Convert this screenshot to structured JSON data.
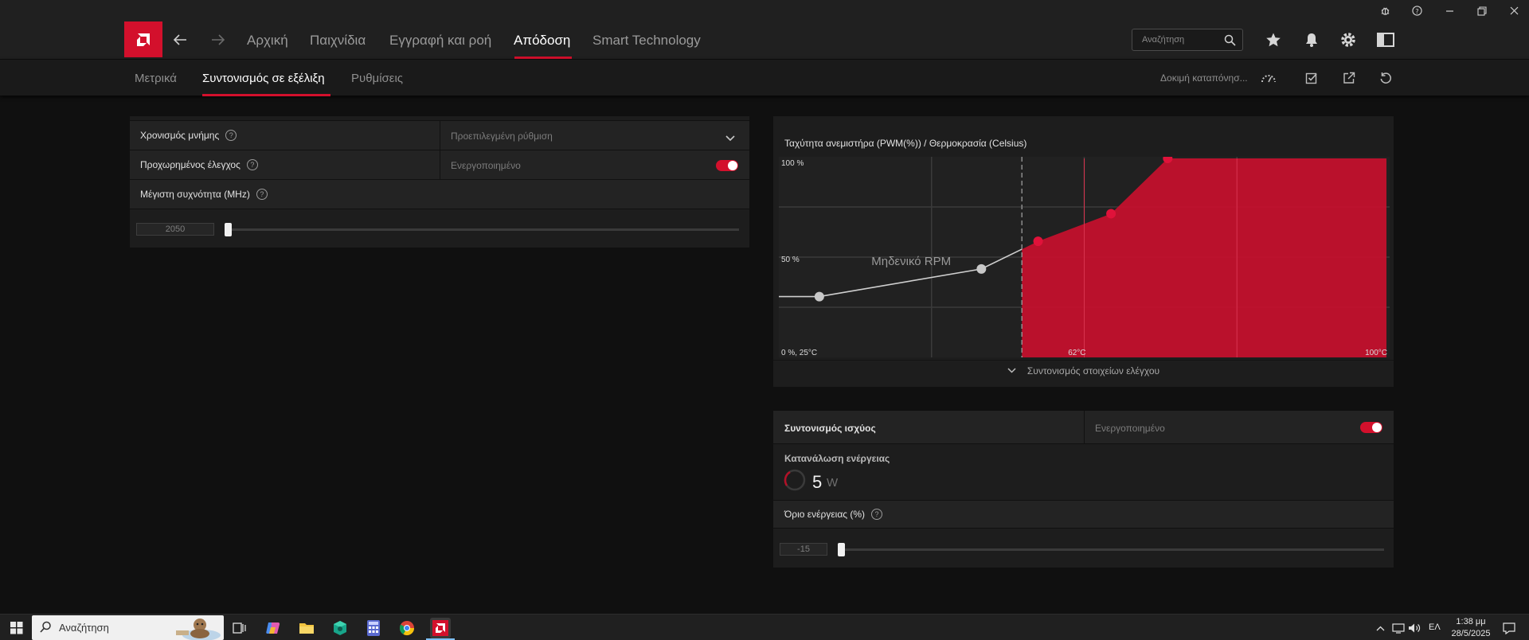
{
  "titlebar": {
    "icons": [
      "bug-icon",
      "help-icon",
      "minimize-icon",
      "restore-icon",
      "close-icon"
    ]
  },
  "nav": {
    "links": [
      "Αρχική",
      "Παιχνίδια",
      "Εγγραφή και ροή",
      "Απόδοση",
      "Smart Technology"
    ],
    "active_index": 3,
    "search_placeholder": "Αναζήτηση"
  },
  "subnav": {
    "tabs": [
      "Μετρικά",
      "Συντονισμός σε εξέλιξη",
      "Ρυθμίσεις"
    ],
    "active_index": 1,
    "stress_test_label": "Δοκιμή καταπόνησ..."
  },
  "left_panel": {
    "memory_timing": {
      "label": "Χρονισμός μνήμης",
      "value": "Προεπιλεγμένη ρύθμιση"
    },
    "advanced_control": {
      "label": "Προχωρημένος έλεγχος",
      "value": "Ενεργοποιημένο",
      "enabled": true
    },
    "max_frequency": {
      "label": "Μέγιστη συχνότητα (MHz)",
      "value": "2050",
      "slider_fraction": 0.0
    }
  },
  "fan_panel": {
    "title": "Ταχύτητα ανεμιστήρα (PWM(%)) / Θερμοκρασία (Celsius)",
    "zero_rpm_label": "Μηδενικό RPM",
    "expand_label": "Συντονισμός στοιχείων ελέγχου"
  },
  "chart_data": {
    "type": "area",
    "title": "Ταχύτητα ανεμιστήρα (PWM(%)) / Θερμοκρασία (Celsius)",
    "y_labels": {
      "max": "100 %",
      "mid": "50 %",
      "min": "0 %, 25°C"
    },
    "x_labels": {
      "mid": "62°C",
      "max": "100°C"
    },
    "xlim": [
      25,
      100
    ],
    "ylim": [
      0,
      100
    ],
    "zero_rpm_threshold": 55,
    "points": [
      {
        "x": 30,
        "y": 30
      },
      {
        "x": 50,
        "y": 44
      },
      {
        "x": 57,
        "y": 58
      },
      {
        "x": 66,
        "y": 72
      },
      {
        "x": 73,
        "y": 100
      },
      {
        "x": 100,
        "y": 100
      }
    ],
    "colors": {
      "fill": "#c8102e",
      "point": "#e0123a",
      "grey_point": "#c8c8c8",
      "line": "#cfcfcf"
    }
  },
  "power_panel": {
    "title": "Συντονισμός ισχύος",
    "status": "Ενεργοποιημένο",
    "enabled": true,
    "consumption_label": "Κατανάλωση ενέργειας",
    "consumption_value": "5",
    "consumption_unit": "W",
    "limit_label": "Όριο ενέργειας (%)",
    "limit_value": "-15",
    "limit_fraction": 0.0
  },
  "taskbar": {
    "search_placeholder": "Αναζήτηση",
    "language": "ΕΛ",
    "time": "1:38 μμ",
    "date": "28/5/2025"
  },
  "colors": {
    "accent": "#d3102c",
    "background": "#101010",
    "panel": "#1d1d1d"
  }
}
